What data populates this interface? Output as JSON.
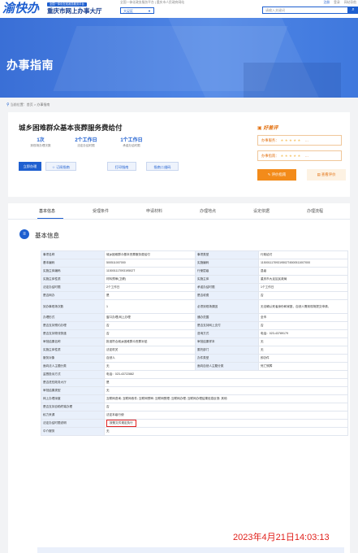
{
  "header": {
    "logo": "渝快办",
    "badge": "全国一体化在线政务服务平台",
    "site_title": "重庆市网上办事大厅",
    "top_links": "全国一体化政务服务平台 | 重庆市人民政府网站",
    "region": "大足区",
    "auth": {
      "register": "注册",
      "login": "登录",
      "nav": "网站导航"
    },
    "search_placeholder": "请输入关键词"
  },
  "banner": {
    "title": "办事指南"
  },
  "breadcrumb": "当前位置：首页 > 办事指南",
  "service": {
    "title": "城乡困难群众基本丧葬服务费给付",
    "stats": [
      {
        "value": "1次",
        "label": "到现场办理次数"
      },
      {
        "value": "2个工作日",
        "label": "法定办结时限"
      },
      {
        "value": "1个工作日",
        "label": "承诺办结时限"
      }
    ],
    "buttons": {
      "apply": "立即办理",
      "subscribe": "订阅指南",
      "print": "打印指南",
      "qrcode": "指南二维码"
    },
    "rating": {
      "title": "好差评",
      "service_label": "办事服务：",
      "guide_label": "办事指南：",
      "stars": "★★★★★",
      "more": "…",
      "evaluate": "评价指南",
      "view": "查看评价"
    }
  },
  "tabs": [
    "基本信息",
    "受理条件",
    "申请材料",
    "办理地点",
    "设定依据",
    "办理流程"
  ],
  "section_title": "基本信息",
  "info_rows": [
    [
      "事项名称",
      "城乡困难群众基本丧葬服务费给付",
      "事项类型",
      "行政给付"
    ],
    [
      "基本编码",
      "500511007000",
      "实施编码",
      "11500111709319502T4500511007000"
    ],
    [
      "实施主体编码",
      "11500111709319502T",
      "行使层级",
      "县级"
    ],
    [
      "实施主体性质",
      "材料预审(卫健)",
      "实施主体",
      "重庆市大足区民政局"
    ],
    [
      "法定办结时限",
      "2个工作日",
      "承诺办结时限",
      "1个工作日"
    ],
    [
      "是否网办",
      "是",
      "是否收费",
      "否"
    ],
    [
      "到办事现场次数",
      "1",
      "必须到现场原因",
      "无法确认死者身份和家庭，自然人需到现场提交申请。"
    ],
    [
      "办理形式",
      "窗口办理,网上办理",
      "通办范围",
      "全市"
    ],
    [
      "是否支持预约办理",
      "否",
      "是否支持网上支付",
      "否"
    ],
    [
      "是否支持物流快递",
      "否",
      "咨询方式",
      "电话：023-43789179"
    ],
    [
      "审批结果名称",
      "批准符合城乡困难群众丧葬补贴",
      "审批结果样本",
      "无"
    ],
    [
      "实施主体性质",
      "法定机关",
      "委托部门",
      "无"
    ],
    [
      "服务对象",
      "自然人",
      "办件类型",
      "即办件"
    ],
    [
      "面向法人主题分类",
      "无",
      "面向自然人主题分类",
      "死亡殡葬"
    ]
  ],
  "info_rows_single": [
    [
      "监督投诉方式",
      "电话：023-43722882"
    ],
    [
      "是否进驻政务大厅",
      "是"
    ],
    [
      "审批结果类型",
      "无"
    ],
    [
      "网上办理深度",
      "互联网咨询; 互联网收件; 互联网预审; 互联网受理; 互联网办理; 互联网办理结果信息反馈; 其他"
    ],
    [
      "是否支持自助终端办理",
      "否"
    ],
    [
      "权力来源",
      "法定本级行使"
    ],
    [
      "法定办结时限说明",
      "按照文件规定执行"
    ],
    [
      "中介服务",
      "无"
    ]
  ],
  "timestamp": "2023年4月21日14:03:13"
}
